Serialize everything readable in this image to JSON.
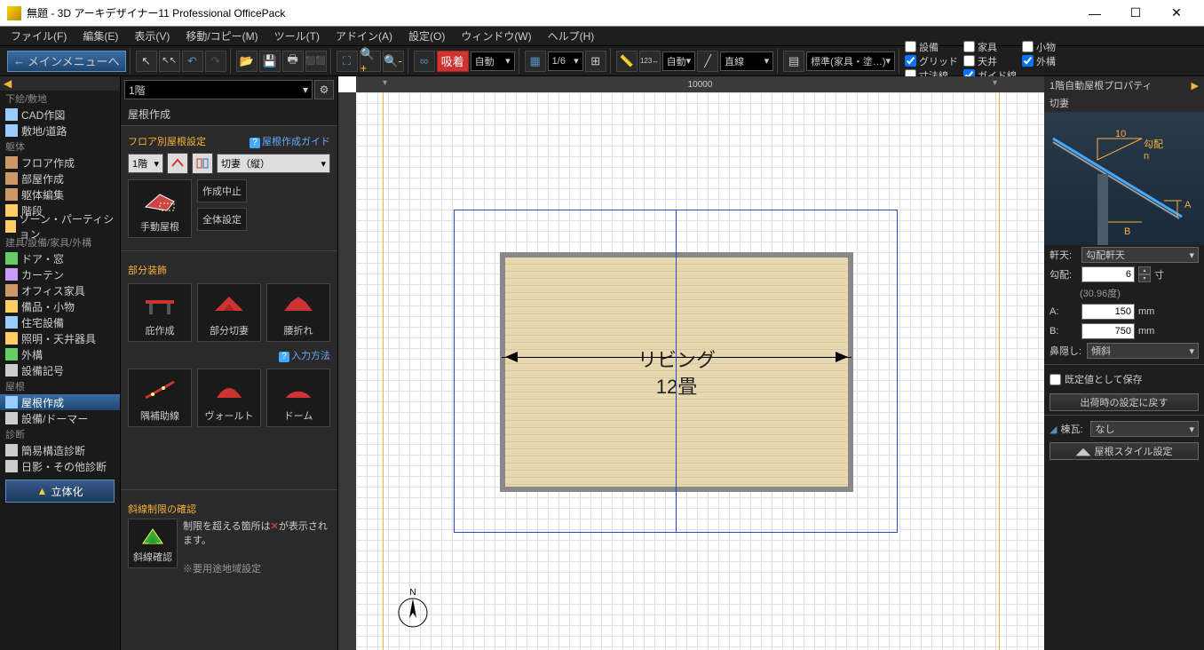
{
  "title": "無題 - 3D アーキデザイナー11 Professional OfficePack",
  "menubar": [
    "ファイル(F)",
    "編集(E)",
    "表示(V)",
    "移動/コピー(M)",
    "ツール(T)",
    "アドイン(A)",
    "設定(O)",
    "ウィンドウ(W)",
    "ヘルプ(H)"
  ],
  "toolbar": {
    "main_menu": "メインメニューへ",
    "snap_label": "吸着",
    "auto1": "自動",
    "grid_frac": "1/6",
    "auto2": "自動",
    "line_style": "直線",
    "layer": "標準(家具・塗…)",
    "checks": [
      {
        "label": "設備",
        "checked": false
      },
      {
        "label": "家具",
        "checked": false
      },
      {
        "label": "小物",
        "checked": false
      },
      {
        "label": "グリッド",
        "checked": true
      },
      {
        "label": "天井",
        "checked": false
      },
      {
        "label": "外構",
        "checked": true
      },
      {
        "label": "寸法線",
        "checked": false
      },
      {
        "label": "ガイド線",
        "checked": true
      }
    ]
  },
  "sidebar": {
    "cats": [
      {
        "name": "下絵/敷地",
        "items": [
          {
            "icon": "cad",
            "label": "CAD作図"
          },
          {
            "icon": "site",
            "label": "敷地/道路"
          }
        ]
      },
      {
        "name": "躯体",
        "items": [
          {
            "icon": "floor",
            "label": "フロア作成"
          },
          {
            "icon": "room",
            "label": "部屋作成"
          },
          {
            "icon": "body",
            "label": "躯体編集"
          },
          {
            "icon": "stair",
            "label": "階段"
          },
          {
            "icon": "zone",
            "label": "ゾーン・パーティション"
          }
        ]
      },
      {
        "name": "建具/設備/家具/外構",
        "items": [
          {
            "icon": "door",
            "label": "ドア・窓"
          },
          {
            "icon": "curtain",
            "label": "カーテン"
          },
          {
            "icon": "office",
            "label": "オフィス家具"
          },
          {
            "icon": "equip",
            "label": "備品・小物"
          },
          {
            "icon": "house",
            "label": "住宅設備"
          },
          {
            "icon": "light",
            "label": "照明・天井器具"
          },
          {
            "icon": "ext",
            "label": "外構"
          },
          {
            "icon": "sym",
            "label": "設備記号"
          }
        ]
      },
      {
        "name": "屋根",
        "items": [
          {
            "icon": "roof",
            "label": "屋根作成",
            "active": true
          },
          {
            "icon": "dormer",
            "label": "設備/ドーマー"
          }
        ]
      },
      {
        "name": "診断",
        "items": [
          {
            "icon": "struct",
            "label": "簡易構造診断"
          },
          {
            "icon": "shadow",
            "label": "日影・その他診断"
          }
        ]
      }
    ],
    "view3d": "立体化"
  },
  "tool_panel": {
    "floor_sel": "1階",
    "title": "屋根作成",
    "sec1_head": "フロア別屋根設定",
    "sec1_help": "屋根作成ガイド",
    "floor_btn": "1階",
    "roof_type": "切妻（縦）",
    "manual_roof": "手動屋根",
    "cancel": "作成中止",
    "overall": "全体設定",
    "sec2_head": "部分装飾",
    "sec2_items": [
      "庇作成",
      "部分切妻",
      "腰折れ"
    ],
    "sec2b_help": "入力方法",
    "sec2b_items": [
      "隅補助線",
      "ヴォールト",
      "ドーム"
    ],
    "sec3_head": "斜線制限の確認",
    "sec3_txt1": "制限を超える箇所は",
    "sec3_txt2": "が表示されます。",
    "sec3_btn": "斜線確認",
    "sec3_note": "※要用途地域設定"
  },
  "canvas": {
    "ruler_h": "10000",
    "room_name": "リビング",
    "room_size": "12畳",
    "compass_n": "N"
  },
  "props": {
    "title": "1階自動屋根プロパティ",
    "head": "切妻",
    "diag_slope_val": "10",
    "diag_slope_lbl": "勾配",
    "diag_n": "n",
    "diag_a": "A",
    "diag_b": "B",
    "eave_lbl": "軒天:",
    "eave_val": "勾配軒天",
    "slope_lbl": "勾配:",
    "slope_val": "6",
    "slope_unit": "寸",
    "slope_deg": "(30.96度)",
    "a_lbl": "A:",
    "a_val": "150",
    "a_unit": "mm",
    "b_lbl": "B:",
    "b_val": "750",
    "b_unit": "mm",
    "nose_lbl": "鼻隠し:",
    "nose_val": "傾斜",
    "save_default": "既定値として保存",
    "reset_btn": "出荷時の設定に戻す",
    "ridge_lbl": "棟瓦:",
    "ridge_val": "なし",
    "style_btn": "屋根スタイル設定"
  }
}
